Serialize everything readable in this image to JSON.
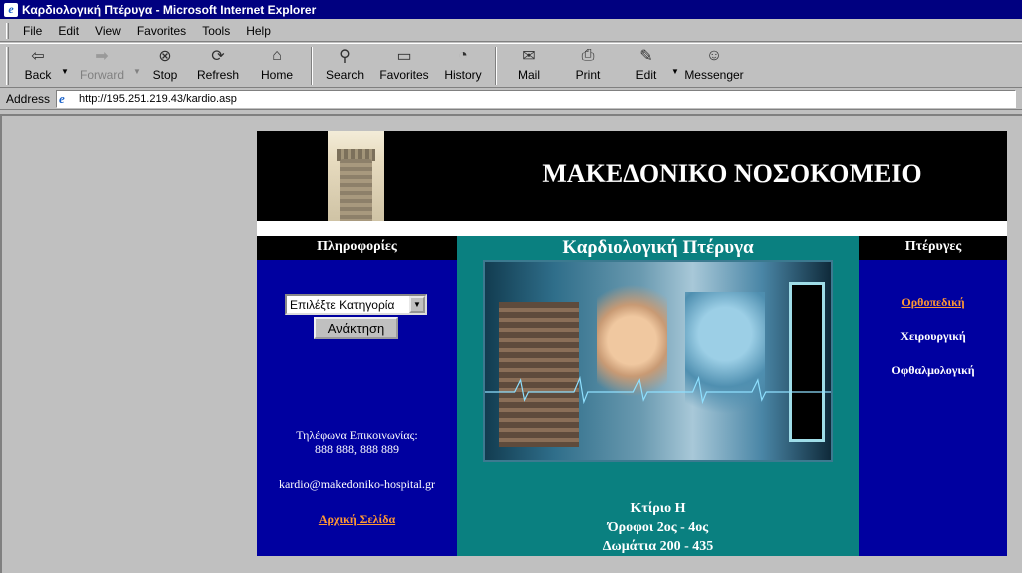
{
  "window": {
    "title": "Καρδιολογική Πτέρυγα - Microsoft Internet Explorer"
  },
  "menu": [
    "File",
    "Edit",
    "View",
    "Favorites",
    "Tools",
    "Help"
  ],
  "toolbar": {
    "back": "Back",
    "forward": "Forward",
    "stop": "Stop",
    "refresh": "Refresh",
    "home": "Home",
    "search": "Search",
    "favorites": "Favorites",
    "history": "History",
    "mail": "Mail",
    "print": "Print",
    "edit": "Edit",
    "messenger": "Messenger"
  },
  "address": {
    "label": "Address",
    "url": "http://195.251.219.43/kardio.asp"
  },
  "page": {
    "hospital_title": "ΜΑΚΕΔΟΝΙΚΟ ΝΟΣΟΚΟΜΕΙΟ",
    "left_heading": "Πληροφορίες",
    "mid_heading": "Καρδιολογική Πτέρυγα",
    "right_heading": "Πτέρυγες",
    "category_select": "Επιλέξτε Κατηγορία",
    "search_button": "Ανάκτηση",
    "phone_label": "Τηλέφωνα Επικοινωνίας:",
    "phone_numbers": "888 888, 888 889",
    "email": "kardio@makedoniko-hospital.gr",
    "home_link": "Αρχική Σελίδα",
    "building": "Κτίριο Η",
    "floors": "Όροφοι 2ος - 4ος",
    "rooms": "Δωμάτια 200 - 435",
    "wings": [
      "Ορθοπεδική",
      "Χειρουργική",
      "Οφθαλμολογική"
    ]
  },
  "colors": {
    "titlebar": "#000080",
    "nav_blue": "#0000a0",
    "teal": "#0a8080",
    "link_orange": "#ff9933"
  }
}
